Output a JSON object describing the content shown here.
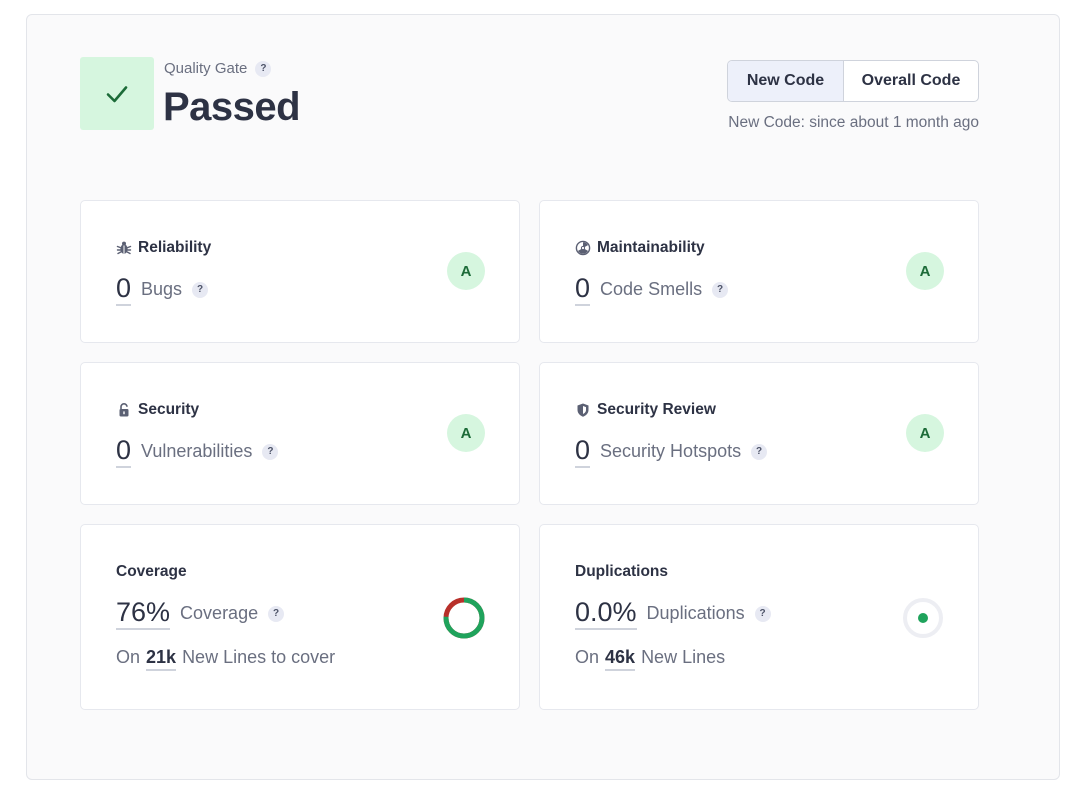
{
  "quality_gate": {
    "label": "Quality Gate",
    "status": "Passed",
    "help_glyph": "?",
    "check_icon": "check-icon"
  },
  "toggle": {
    "new_code": "New Code",
    "overall_code": "Overall Code",
    "active": "new_code"
  },
  "new_code_note": "New Code: since about 1 month ago",
  "cards": {
    "reliability": {
      "title": "Reliability",
      "icon": "bug-icon",
      "value": "0",
      "label": "Bugs",
      "rating": "A"
    },
    "maintainability": {
      "title": "Maintainability",
      "icon": "radiation-icon",
      "value": "0",
      "label": "Code Smells",
      "rating": "A"
    },
    "security": {
      "title": "Security",
      "icon": "lock-icon",
      "value": "0",
      "label": "Vulnerabilities",
      "rating": "A"
    },
    "security_review": {
      "title": "Security Review",
      "icon": "shield-icon",
      "value": "0",
      "label": "Security Hotspots",
      "rating": "A"
    },
    "coverage": {
      "title": "Coverage",
      "value": "76%",
      "label": "Coverage",
      "sub_prefix": "On",
      "sub_value": "21k",
      "sub_label": "New Lines to cover",
      "percent": 76
    },
    "duplications": {
      "title": "Duplications",
      "value": "0.0%",
      "label": "Duplications",
      "sub_prefix": "On",
      "sub_value": "46k",
      "sub_label": "New Lines",
      "percent": 0.0
    }
  },
  "colors": {
    "passed_bg": "#d6f6df",
    "passed_fg": "#1c6b38",
    "coverage_good": "#1fa35c",
    "coverage_bad": "#b8302a",
    "duplication_dot": "#1fa35c"
  }
}
